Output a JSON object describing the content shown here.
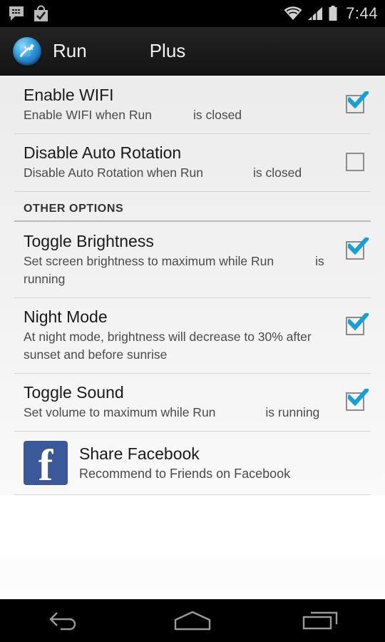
{
  "status_bar": {
    "notification_icons": [
      "bbm-chat-icon",
      "play-store-bag-icon"
    ],
    "system_icons": [
      "wifi-icon",
      "cell-signal-icon",
      "battery-icon"
    ],
    "clock": "7:44"
  },
  "action_bar": {
    "app_icon": "tools-wrench-icon",
    "title_part1": "Run",
    "title_part2": "Plus"
  },
  "settings": [
    {
      "name": "enable-wifi",
      "title": "Enable WIFI",
      "sub_a": "Enable WIFI when Run",
      "sub_b": "is closed",
      "checked": true
    },
    {
      "name": "disable-auto-rotation",
      "title": "Disable Auto Rotation",
      "sub_a": "Disable Auto Rotation when Run",
      "sub_b": "is closed",
      "checked": false
    }
  ],
  "section": {
    "title": "OTHER OPTIONS"
  },
  "other_options": [
    {
      "name": "toggle-brightness",
      "title": "Toggle Brightness",
      "sub_a": "Set screen brightness to maximum while Run",
      "sub_b": "is running",
      "checked": true
    },
    {
      "name": "night-mode",
      "title": "Night Mode",
      "sub_a": "At night mode, brightness will decrease to 30% after sunset and before sunrise",
      "sub_b": "",
      "checked": true
    },
    {
      "name": "toggle-sound",
      "title": "Toggle Sound",
      "sub_a": "Set volume to maximum while Run",
      "sub_b": "is running",
      "checked": true
    }
  ],
  "facebook": {
    "icon": "facebook-icon",
    "icon_glyph": "f",
    "title": "Share Facebook",
    "subtitle": "Recommend to Friends on Facebook",
    "brand_color": "#3b5998"
  },
  "nav_bar": {
    "buttons": [
      "back-icon",
      "home-icon",
      "recents-icon"
    ]
  },
  "colors": {
    "accent_checkbox": "#1a9fd4",
    "action_bar": "#1b1b1b",
    "list_background": "#f0f0f0"
  }
}
